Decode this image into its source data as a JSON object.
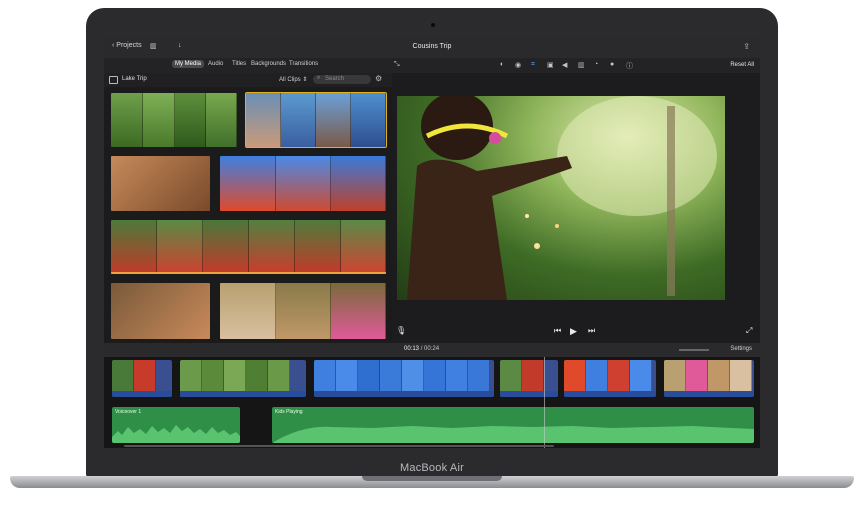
{
  "window": {
    "title": "Cousins Trip",
    "projects_label": "Projects"
  },
  "media_tabs": [
    {
      "label": "My Media",
      "active": true
    },
    {
      "label": "Audio",
      "active": false
    },
    {
      "label": "Titles",
      "active": false
    },
    {
      "label": "Backgrounds",
      "active": false
    },
    {
      "label": "Transitions",
      "active": false
    }
  ],
  "library": {
    "title": "Lake Trip",
    "filter": "All Clips ⇕",
    "search_placeholder": "Search"
  },
  "viewer": {
    "reset_label": "Reset All"
  },
  "timeline": {
    "current_time": "00:13",
    "total_time": "00:24",
    "settings_label": "Settings",
    "audio_clips": [
      {
        "label": "Voiceover 1"
      },
      {
        "label": "Kids Playing"
      }
    ]
  },
  "device": {
    "brand": "MacBook Air"
  },
  "colors": {
    "selection": "#e0b020",
    "clip_bar": "#f2a23b",
    "audio": "#2f8f47",
    "video_strip": "#2a4c9c"
  }
}
